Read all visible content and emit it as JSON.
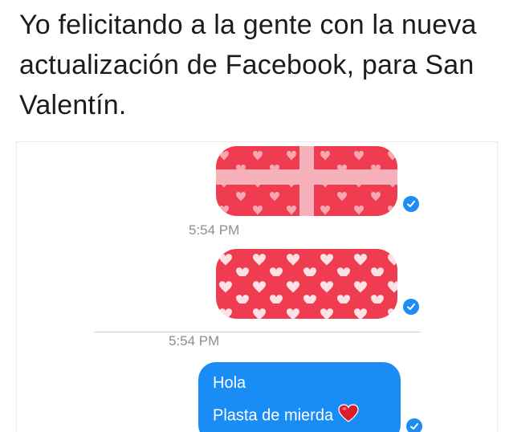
{
  "caption": {
    "text": "Yo felicitando a la gente con la nueva actualización de Facebook, para San Valentín."
  },
  "chat": {
    "timestamp_1": "5:54 PM",
    "timestamp_2": "5:54 PM",
    "message_lines": [
      "Hola",
      "Plasta de mierda"
    ],
    "sticker_1": "gift-wrapped-heart-bubble",
    "sticker_2": "heart-pattern-bubble",
    "emoji": "red-heart-icon",
    "read_receipt_icon": "check-circle-icon"
  },
  "colors": {
    "bubble_red": "#ef3c51",
    "ribbon_pink": "#f7b1bb",
    "messenger_blue": "#1a8cf5",
    "timestamp_gray": "#8e8e93"
  }
}
